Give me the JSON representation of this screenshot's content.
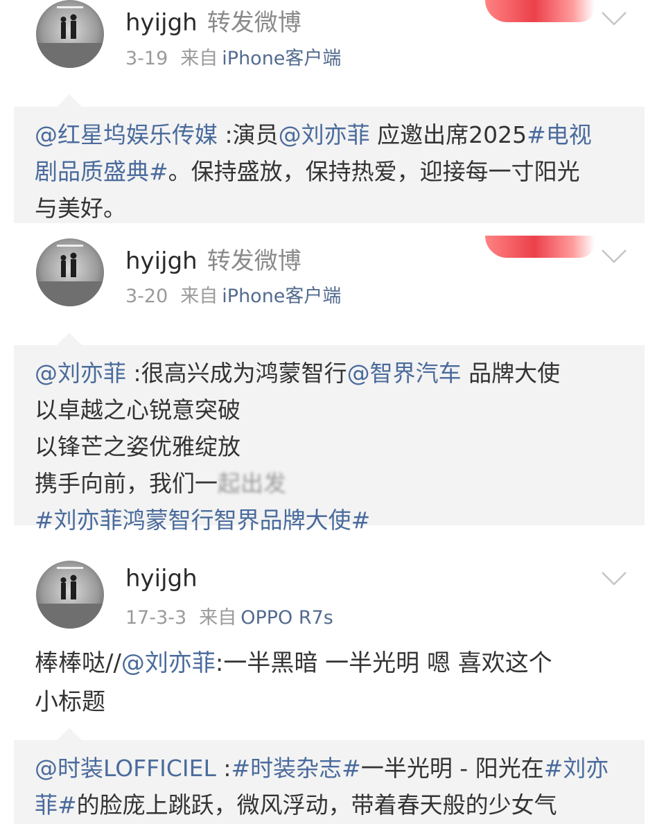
{
  "feed": [
    {
      "username": "hyijgh",
      "action": "转发微博",
      "date": "3-19",
      "from_label": "来自",
      "source": "iPhone客户端",
      "repost_lines": [
        [
          {
            "text": "@红星坞娱乐传媒",
            "link": true
          },
          {
            "text": " :演员",
            "link": false
          },
          {
            "text": "@刘亦菲",
            "link": true
          },
          {
            "text": " 应邀出席2025",
            "link": false
          },
          {
            "text": "#电视",
            "link": true
          }
        ],
        [
          {
            "text": "剧品质盛典#",
            "link": true
          },
          {
            "text": "。保持盛放，保持热爱，迎接每一寸阳光",
            "link": false
          }
        ],
        [
          {
            "text": "与美好。",
            "link": false
          }
        ]
      ]
    },
    {
      "username": "hyijgh",
      "action": "转发微博",
      "date": "3-20",
      "from_label": "来自",
      "source": "iPhone客户端",
      "repost_lines": [
        [
          {
            "text": "@刘亦菲",
            "link": true
          },
          {
            "text": " :很高兴成为鸿蒙智行",
            "link": false
          },
          {
            "text": "@智界汽车",
            "link": true
          },
          {
            "text": " 品牌大使",
            "link": false
          }
        ],
        [
          {
            "text": "以卓越之心锐意突破",
            "link": false
          }
        ],
        [
          {
            "text": "以锋芒之姿优雅绽放",
            "link": false
          }
        ],
        [
          {
            "text": "携手向前，我们一",
            "link": false
          },
          {
            "text": "起出发",
            "link": false,
            "blur": true
          }
        ],
        [
          {
            "text": "#刘亦菲鸿蒙智行智界品牌大使#",
            "link": true
          }
        ]
      ]
    },
    {
      "username": "hyijgh",
      "date": "17-3-3",
      "from_label": "来自",
      "source": "OPPO R7s",
      "body_lines": [
        [
          {
            "text": "棒棒哒//",
            "link": false
          },
          {
            "text": "@刘亦菲",
            "link": true
          },
          {
            "text": ":一半黑暗 一半光明 嗯 喜欢这个",
            "link": false
          }
        ],
        [
          {
            "text": "小标题",
            "link": false
          }
        ]
      ],
      "repost_lines": [
        [
          {
            "text": "@时装LOFFICIEL",
            "link": true
          },
          {
            "text": " :",
            "link": false
          },
          {
            "text": "#时装杂志#",
            "link": true
          },
          {
            "text": "一半光明 - 阳光在",
            "link": false
          },
          {
            "text": "#刘亦",
            "link": true
          }
        ],
        [
          {
            "text": "菲#",
            "link": true
          },
          {
            "text": "的脸庞上跳跃，微风浮动，带着春天般的少女气",
            "link": false
          }
        ]
      ]
    }
  ],
  "icons": {
    "avatar": "avatar-photo-icon",
    "menu": "chevron-down-icon"
  },
  "colors": {
    "link": "#4a6b9c",
    "username": "#2a2a2a",
    "meta": "#9a9a9a",
    "repost_bg": "#f3f3f3"
  }
}
